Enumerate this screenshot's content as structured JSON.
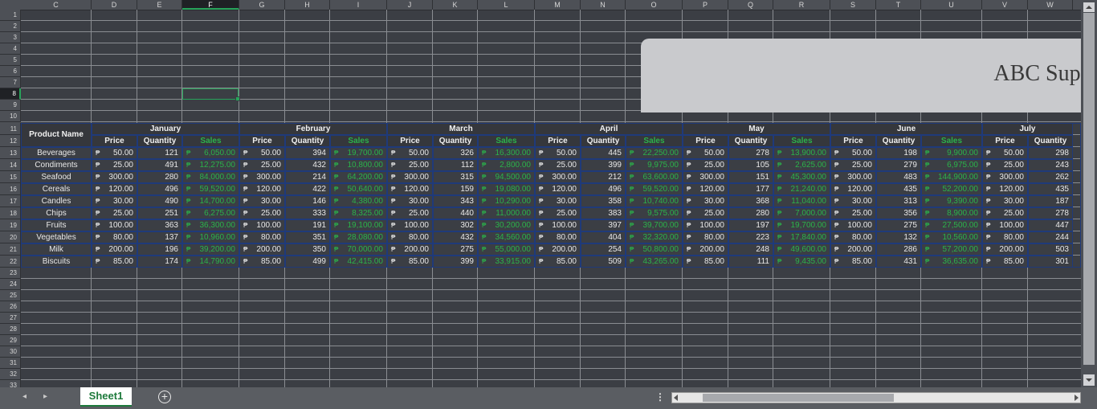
{
  "columns": [
    "C",
    "D",
    "E",
    "F",
    "G",
    "H",
    "I",
    "J",
    "K",
    "L",
    "M",
    "N",
    "O",
    "P",
    "Q",
    "R",
    "S",
    "T",
    "U",
    "V",
    "W"
  ],
  "selected_column": "F",
  "rows": [
    "1",
    "2",
    "3",
    "4",
    "5",
    "6",
    "7",
    "8",
    "9",
    "10",
    "11",
    "12",
    "13",
    "14",
    "15",
    "16",
    "17",
    "18",
    "19",
    "20",
    "21",
    "22",
    "23",
    "24",
    "25",
    "26",
    "27",
    "28",
    "29",
    "30",
    "31",
    "32",
    "33"
  ],
  "selected_row": "8",
  "title": "ABC Supe",
  "table": {
    "product_header": "Product Name",
    "currency_symbol": "₱",
    "months": [
      "January",
      "February",
      "March",
      "April",
      "May",
      "June",
      "July"
    ],
    "subheaders": [
      "Price",
      "Quantity",
      "Sales"
    ],
    "products": [
      "Beverages",
      "Condiments",
      "Seafood",
      "Cereals",
      "Candles",
      "Chips",
      "Fruits",
      "Vegetables",
      "Milk",
      "Biscuits"
    ],
    "prices": [
      "50.00",
      "25.00",
      "300.00",
      "120.00",
      "30.00",
      "25.00",
      "100.00",
      "80.00",
      "200.00",
      "85.00"
    ],
    "quantities": [
      [
        121,
        394,
        326,
        445,
        278,
        198,
        298
      ],
      [
        491,
        432,
        112,
        399,
        105,
        279,
        243
      ],
      [
        280,
        214,
        315,
        212,
        151,
        483,
        262
      ],
      [
        496,
        422,
        159,
        496,
        177,
        435,
        435
      ],
      [
        490,
        146,
        343,
        358,
        368,
        313,
        187
      ],
      [
        251,
        333,
        440,
        383,
        280,
        356,
        278
      ],
      [
        363,
        191,
        302,
        397,
        197,
        275,
        447
      ],
      [
        137,
        351,
        432,
        404,
        223,
        132,
        244
      ],
      [
        196,
        350,
        275,
        254,
        248,
        286,
        503
      ],
      [
        174,
        499,
        399,
        509,
        111,
        431,
        301
      ]
    ],
    "sales": [
      [
        "6,050.00",
        "19,700.00",
        "16,300.00",
        "22,250.00",
        "13,900.00",
        "9,900.00"
      ],
      [
        "12,275.00",
        "10,800.00",
        "2,800.00",
        "9,975.00",
        "2,625.00",
        "6,975.00"
      ],
      [
        "84,000.00",
        "64,200.00",
        "94,500.00",
        "63,600.00",
        "45,300.00",
        "144,900.00"
      ],
      [
        "59,520.00",
        "50,640.00",
        "19,080.00",
        "59,520.00",
        "21,240.00",
        "52,200.00"
      ],
      [
        "14,700.00",
        "4,380.00",
        "10,290.00",
        "10,740.00",
        "11,040.00",
        "9,390.00"
      ],
      [
        "6,275.00",
        "8,325.00",
        "11,000.00",
        "9,575.00",
        "7,000.00",
        "8,900.00"
      ],
      [
        "36,300.00",
        "19,100.00",
        "30,200.00",
        "39,700.00",
        "19,700.00",
        "27,500.00"
      ],
      [
        "10,960.00",
        "28,080.00",
        "34,560.00",
        "32,320.00",
        "17,840.00",
        "10,560.00"
      ],
      [
        "39,200.00",
        "70,000.00",
        "55,000.00",
        "50,800.00",
        "49,600.00",
        "57,200.00"
      ],
      [
        "14,790.00",
        "42,415.00",
        "33,915.00",
        "43,265.00",
        "9,435.00",
        "36,635.00"
      ]
    ]
  },
  "sheet_tab": "Sheet1",
  "colors": {
    "grid_bg": "#3b3e44",
    "header_border": "#1f3a7a",
    "sales_green": "#2bb34a",
    "selection": "#27a35a",
    "title_box": "#c9cacd"
  }
}
